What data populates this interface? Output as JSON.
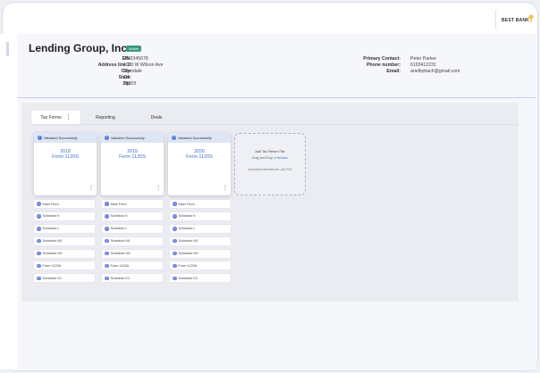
{
  "topbar": {
    "bank_name": "BEST BANK"
  },
  "company": {
    "name": "Lending Group, Inc.",
    "status": "Active",
    "labels": [
      "EIN:",
      "Address line 1:",
      "City:",
      "State:",
      "Zip:"
    ],
    "values": [
      "25-2345678",
      "1120 W Wilson Ave",
      "Glendale",
      "CA",
      "91203"
    ],
    "contact_labels": [
      "Primary Contact:",
      "Phone number:",
      "Email:"
    ],
    "contact_values": [
      "Peter Parker",
      "6193412231",
      "arielbybach@gmail.com"
    ]
  },
  "tabs": [
    {
      "label": "Tax Forms"
    },
    {
      "label": "Reporting"
    },
    {
      "label": "Deals"
    }
  ],
  "cards": [
    {
      "status": "Validated Successfully",
      "year": "2018",
      "form": "Form 1120S"
    },
    {
      "status": "Validated Successfully",
      "year": "2019",
      "form": "Form 1120S"
    },
    {
      "status": "Validated Successfully",
      "year": "2020",
      "form": "Form 1120S"
    }
  ],
  "upload": {
    "title": "Add Tax Return File",
    "drag_text": "Drag and Drop or",
    "browse_text": "Browse",
    "note": "Accepted extensions are .pdf, PDF"
  },
  "schedules": [
    [
      "Main Form",
      "Schedule K",
      "Schedule L",
      "Schedule M1",
      "Schedule M2",
      "Form 1125A",
      "Schedule K1"
    ],
    [
      "Main Form",
      "Schedule K",
      "Schedule L",
      "Schedule M1",
      "Schedule M2",
      "Form 1125A",
      "Schedule K1"
    ],
    [
      "Main Form",
      "Schedule K",
      "Schedule L",
      "Schedule M1",
      "Schedule M2",
      "Form 1125A",
      "Schedule K1"
    ]
  ],
  "colors": {
    "accent": "#3a6fd1",
    "badge": "#3a9b7a",
    "check": "#4e7ad8"
  }
}
